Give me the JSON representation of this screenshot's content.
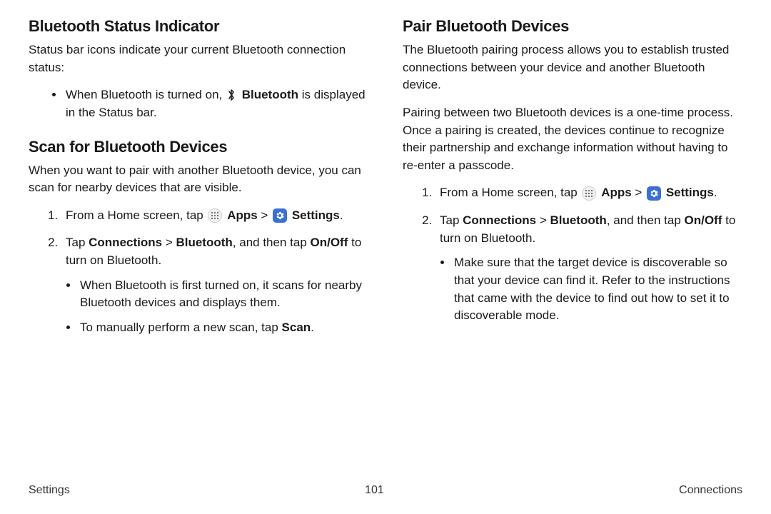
{
  "left": {
    "section1": {
      "heading": "Bluetooth Status Indicator",
      "intro": "Status bar icons indicate your current Bluetooth connection status:",
      "bullet_pre": "When Bluetooth is turned on, ",
      "bullet_bold": "Bluetooth",
      "bullet_post": " is displayed in the Status bar."
    },
    "section2": {
      "heading": "Scan for Bluetooth Devices",
      "intro": "When you want to pair with another Bluetooth device, you can scan for nearby devices that are visible.",
      "step1_pre": "From a Home screen, tap ",
      "apps_label": "Apps",
      "caret": " > ",
      "settings_label": "Settings",
      "step1_post": ".",
      "step2_pre": "Tap ",
      "step2_b1": "Connections",
      "step2_mid1": " > ",
      "step2_b2": "Bluetooth",
      "step2_mid2": ", and then tap ",
      "step2_b3": "On/Off",
      "step2_post": " to turn on Bluetooth.",
      "sub1": "When Bluetooth is first turned on, it scans for nearby Bluetooth devices and displays them.",
      "sub2_pre": "To manually perform a new scan, tap ",
      "sub2_b": "Scan",
      "sub2_post": "."
    }
  },
  "right": {
    "heading": "Pair Bluetooth Devices",
    "p1": "The Bluetooth pairing process allows you to establish trusted connections between your device and another Bluetooth device.",
    "p2": "Pairing between two Bluetooth devices is a one-time process. Once a pairing is created, the devices continue to recognize their partnership and exchange information without having to re-enter a passcode.",
    "step1_pre": "From a Home screen, tap ",
    "apps_label": "Apps",
    "caret": " > ",
    "settings_label": "Settings",
    "step1_post": ".",
    "step2_pre": "Tap ",
    "step2_b1": "Connections",
    "step2_mid1": " > ",
    "step2_b2": "Bluetooth",
    "step2_mid2": ", and then tap ",
    "step2_b3": "On/Off",
    "step2_post": " to turn on Bluetooth.",
    "sub1": "Make sure that the target device is discoverable so that your device can find it. Refer to the instructions that came with the device to find out how to set it to discoverable mode."
  },
  "footer": {
    "left": "Settings",
    "center": "101",
    "right": "Connections"
  }
}
